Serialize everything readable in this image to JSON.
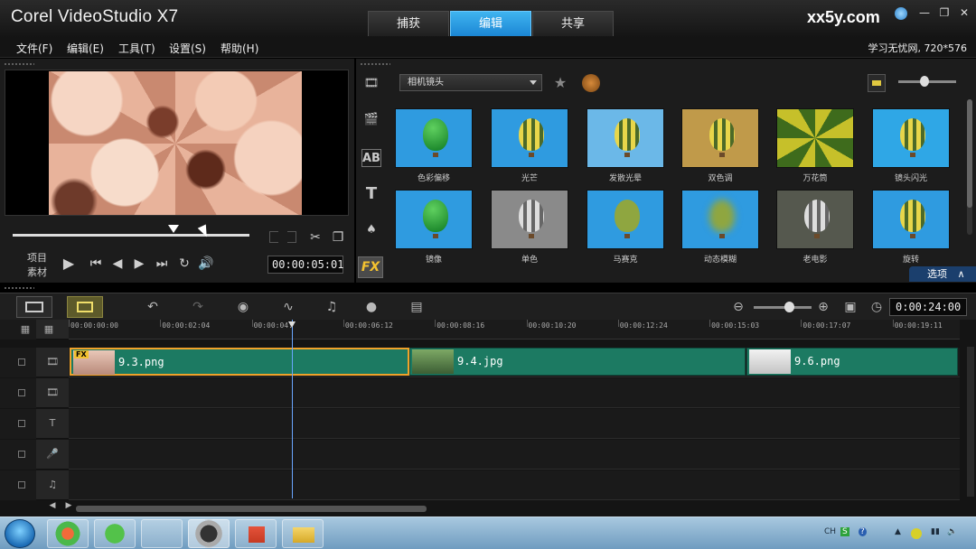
{
  "titlebar": {
    "app_title": "Corel VideoStudio X7",
    "tabs": [
      {
        "label": "捕获",
        "active": false
      },
      {
        "label": "编辑",
        "active": true
      },
      {
        "label": "共享",
        "active": false
      }
    ],
    "brand": "xx5y.com"
  },
  "menu": {
    "items": [
      "文件(F)",
      "编辑(E)",
      "工具(T)",
      "设置(S)",
      "帮助(H)"
    ],
    "right_info": "学习无忧网, 720*576"
  },
  "preview": {
    "mode_project": "项目",
    "mode_clip": "素材",
    "timecode": "00:00:05:01",
    "scrub_position": 0.68
  },
  "library": {
    "category": "相机镜头",
    "sidebar_icons": [
      "media-icon",
      "instant-project-icon",
      "transition-icon",
      "title-icon",
      "graphic-icon",
      "filter-icon"
    ],
    "fx_label": "FX",
    "filters": [
      {
        "label": "色彩偏移",
        "color": "#2f9be0"
      },
      {
        "label": "光芒",
        "color": "#2f9be0"
      },
      {
        "label": "发散光晕",
        "color": "#6bb8e8"
      },
      {
        "label": "双色调",
        "color": "#c09a4a"
      },
      {
        "label": "万花筒",
        "color": "#b3a728"
      },
      {
        "label": "镜头闪光",
        "color": "#2fa7e6"
      },
      {
        "label": "镜像",
        "color": "#2f9be0"
      },
      {
        "label": "单色",
        "color": "#8a8a8a"
      },
      {
        "label": "马赛克",
        "color": "#2f9be0"
      },
      {
        "label": "动态模糊",
        "color": "#2f9be0"
      },
      {
        "label": "老电影",
        "color": "#55584e"
      },
      {
        "label": "旋转",
        "color": "#2f9be0"
      }
    ],
    "options_label": "选项"
  },
  "toolbar": {
    "duration": "0:00:24:00"
  },
  "timeline": {
    "ruler": [
      "00:00:00:00",
      "00:00:02:04",
      "00:00:04:",
      "00:00:06:12",
      "00:00:08:16",
      "00:00:10:20",
      "00:00:12:24",
      "00:00:15:03",
      "00:00:17:07",
      "00:00:19:11"
    ],
    "clips": [
      {
        "label": "9.3.png",
        "selected": true,
        "fx": "FX"
      },
      {
        "label": "9.4.jpg",
        "selected": false
      },
      {
        "label": "9.6.png",
        "selected": false
      }
    ]
  },
  "taskbar": {
    "tray": [
      "CH",
      "S",
      "?"
    ]
  }
}
